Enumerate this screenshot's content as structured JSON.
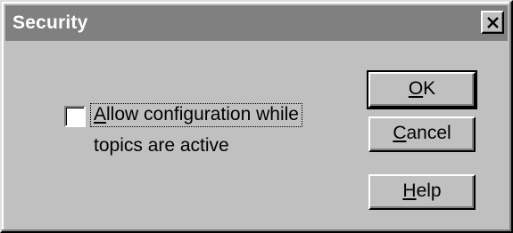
{
  "dialog": {
    "title": "Security",
    "close_icon": "close-icon"
  },
  "checkbox": {
    "checked": false,
    "label_line1": "Allow configuration while",
    "label_line2": "topics are active"
  },
  "buttons": {
    "ok": {
      "mnemonic": "O",
      "rest": "K"
    },
    "cancel": {
      "mnemonic": "C",
      "rest": "ancel"
    },
    "help": {
      "mnemonic": "H",
      "rest": "elp"
    }
  },
  "colors": {
    "face": "#c0c0c0",
    "titlebar_inactive": "#808080",
    "title_text": "#ffffff"
  }
}
